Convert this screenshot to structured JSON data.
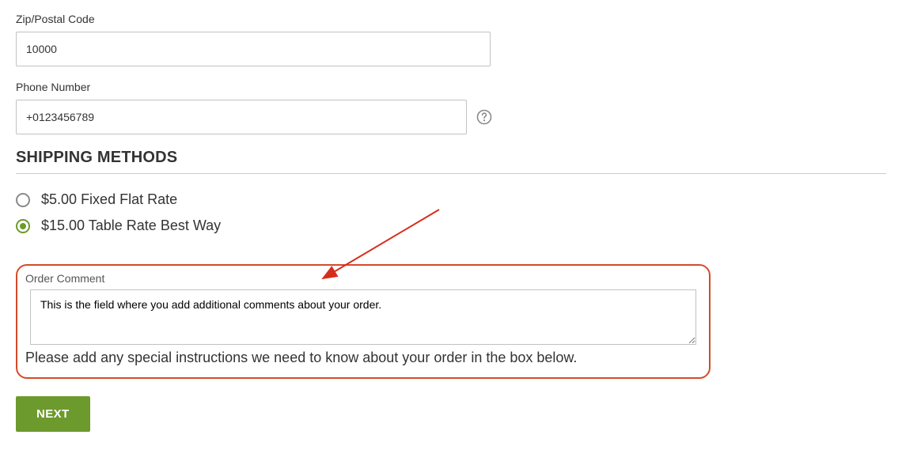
{
  "zip_field": {
    "label": "Zip/Postal Code",
    "value": "10000"
  },
  "phone_field": {
    "label": "Phone Number",
    "value": "+0123456789"
  },
  "shipping": {
    "heading": "SHIPPING METHODS",
    "options": [
      {
        "price": "$5.00",
        "method": "Fixed",
        "carrier": "Flat Rate",
        "selected": false
      },
      {
        "price": "$15.00",
        "method": "Table Rate",
        "carrier": "Best Way",
        "selected": true
      }
    ]
  },
  "order_comment": {
    "label": "Order Comment",
    "value": "This is the field where you add additional comments about your order.",
    "hint": "Please add any special instructions we need to know about your order in the box below."
  },
  "next_button_label": "NEXT",
  "colors": {
    "accent_green": "#6d9a2d",
    "highlight_red": "#d44b2a"
  }
}
